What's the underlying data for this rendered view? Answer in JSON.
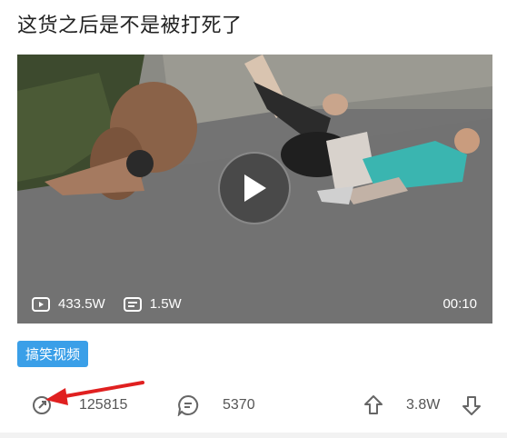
{
  "post": {
    "title": "这货之后是不是被打死了"
  },
  "video": {
    "plays": "433.5W",
    "comments_count": "1.5W",
    "duration": "00:10"
  },
  "tag": {
    "label": "搞笑视频"
  },
  "actions": {
    "share_count": "125815",
    "comment_count": "5370",
    "vote_count": "3.8W"
  },
  "colors": {
    "tag_bg": "#3a9fe8",
    "annotation_arrow": "#e02020"
  }
}
